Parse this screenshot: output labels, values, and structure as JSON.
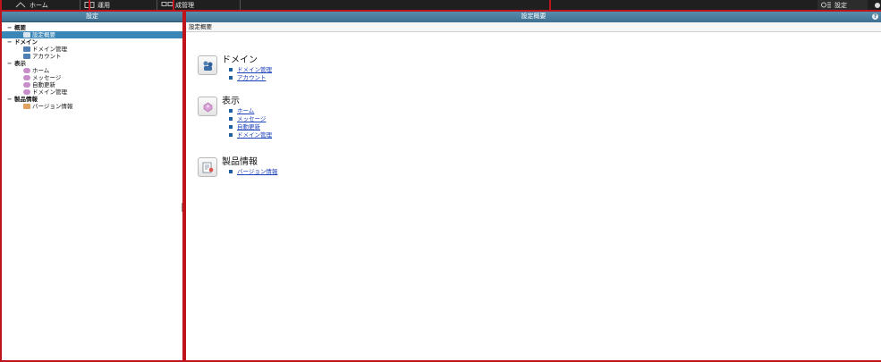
{
  "topbar": {
    "tabs": [
      {
        "label": "ホーム",
        "icon": "home-icon"
      },
      {
        "label": "運用",
        "icon": "operations-icon"
      },
      {
        "label": "成管理",
        "icon": "configuration-icon"
      }
    ],
    "settings_label": "設定"
  },
  "left_pane": {
    "title": "設定",
    "tree": [
      {
        "category": "概要",
        "items": [
          {
            "label": "設定概要",
            "icon": "settings-overview-icon",
            "selected": true
          }
        ]
      },
      {
        "category": "ドメイン",
        "items": [
          {
            "label": "ドメイン管理",
            "icon": "domain-icon"
          },
          {
            "label": "アカウント",
            "icon": "account-icon"
          }
        ]
      },
      {
        "category": "表示",
        "items": [
          {
            "label": "ホーム",
            "icon": "display-icon"
          },
          {
            "label": "メッセージ",
            "icon": "display-icon"
          },
          {
            "label": "自動更新",
            "icon": "display-icon"
          },
          {
            "label": "ドメイン管理",
            "icon": "display-icon"
          }
        ]
      },
      {
        "category": "製品情報",
        "items": [
          {
            "label": "バージョン情報",
            "icon": "version-icon"
          }
        ]
      }
    ]
  },
  "right_pane": {
    "title": "設定概要",
    "subtitle": "設定概要",
    "help": "?",
    "sections": [
      {
        "title": "ドメイン",
        "icon": "domain-section-icon",
        "links": [
          "ドメイン管理",
          "アカウント"
        ]
      },
      {
        "title": "表示",
        "icon": "display-section-icon",
        "links": [
          "ホーム",
          "メッセージ",
          "自動更新",
          "ドメイン管理"
        ]
      },
      {
        "title": "製品情報",
        "icon": "product-info-section-icon",
        "links": [
          "バージョン情報"
        ]
      }
    ]
  },
  "colors": {
    "header": "#3e6f90",
    "selection": "#3a87b7",
    "link": "#1b3fb8",
    "annotation_red": "#c0141c"
  }
}
